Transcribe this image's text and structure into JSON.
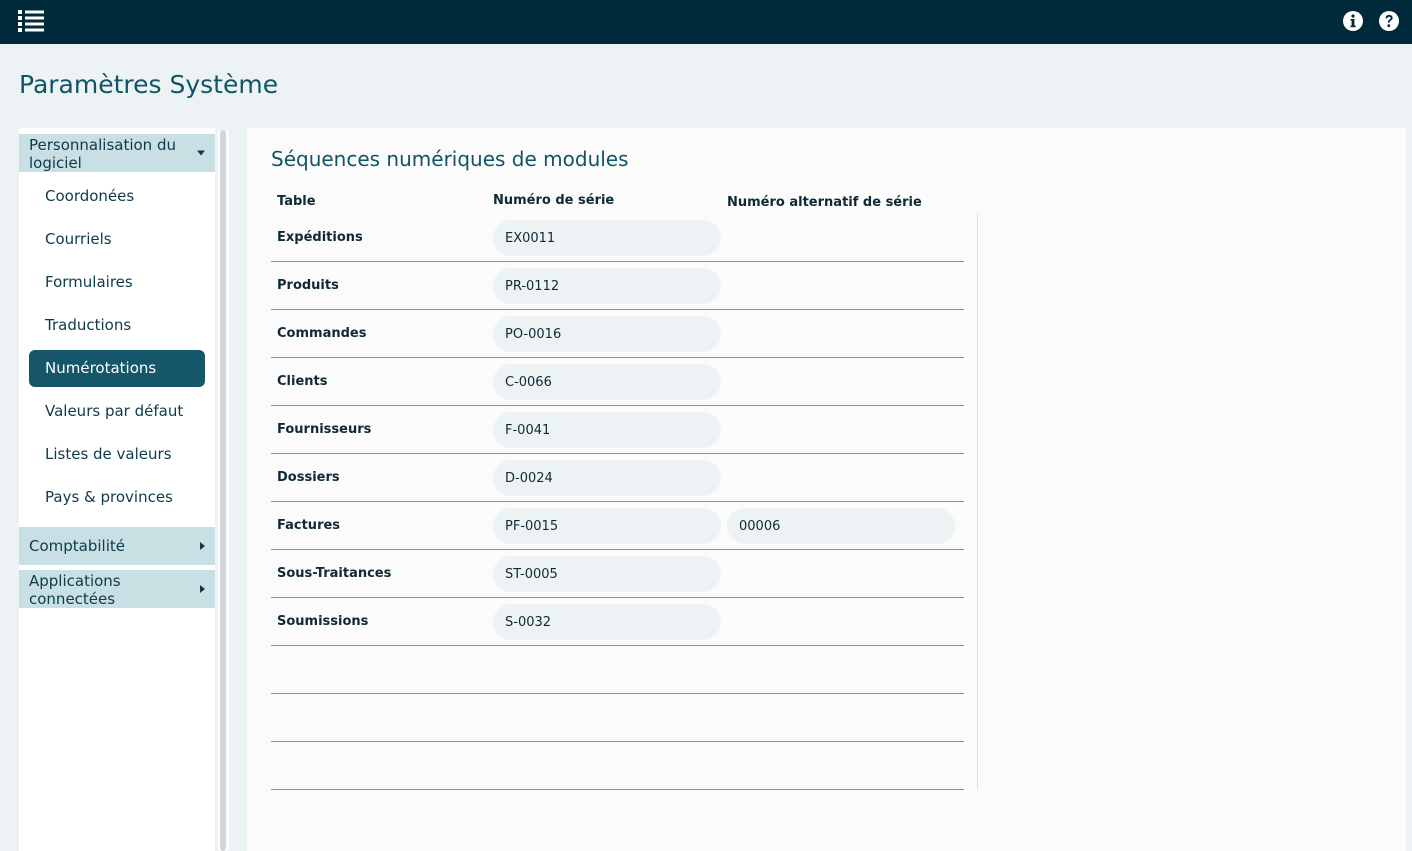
{
  "topbar": {
    "menu_icon": "list-menu-icon",
    "info_icon": "info-circle-icon",
    "help_icon": "question-circle-icon",
    "background": "#002a3a"
  },
  "page": {
    "title": "Paramètres Système"
  },
  "sidebar": {
    "sections": [
      {
        "label": "Personnalisation du logiciel",
        "expanded": true
      },
      {
        "label": "Comptabilité",
        "expanded": false
      },
      {
        "label": "Applications connectées",
        "expanded": false
      }
    ],
    "items": [
      {
        "label": "Coordonées"
      },
      {
        "label": "Courriels"
      },
      {
        "label": "Formulaires"
      },
      {
        "label": "Traductions"
      },
      {
        "label": "Numérotations",
        "active": true
      },
      {
        "label": "Valeurs par défaut"
      },
      {
        "label": "Listes de valeurs"
      },
      {
        "label": "Pays & provinces"
      }
    ],
    "active_color": "#16566a"
  },
  "main": {
    "title": "Séquences numériques de modules",
    "columns": {
      "table": "Table",
      "serial": "Numéro de série",
      "alt_serial": "Numéro alternatif de série"
    },
    "rows": [
      {
        "table": "Expéditions",
        "serial": "EX0011",
        "alt_serial": ""
      },
      {
        "table": "Produits",
        "serial": "PR-0112",
        "alt_serial": ""
      },
      {
        "table": "Commandes",
        "serial": "PO-0016",
        "alt_serial": ""
      },
      {
        "table": "Clients",
        "serial": "C-0066",
        "alt_serial": ""
      },
      {
        "table": "Fournisseurs",
        "serial": "F-0041",
        "alt_serial": ""
      },
      {
        "table": "Dossiers",
        "serial": "D-0024",
        "alt_serial": ""
      },
      {
        "table": "Factures",
        "serial": "PF-0015",
        "alt_serial": "00006"
      },
      {
        "table": "Sous-Traitances",
        "serial": "ST-0005",
        "alt_serial": ""
      },
      {
        "table": "Soumissions",
        "serial": "S-0032",
        "alt_serial": ""
      }
    ]
  }
}
